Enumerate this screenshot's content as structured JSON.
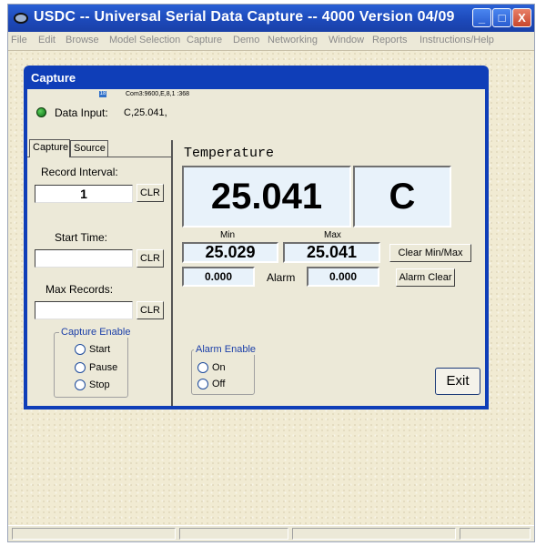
{
  "window": {
    "title": "USDC -- Universal Serial Data Capture -- 4000   Version 04/09",
    "minimize": "_",
    "maximize": "□",
    "close": "X"
  },
  "menu": [
    "File",
    "Edit",
    "Browse",
    "Model Selection",
    "Capture",
    "Demo",
    "Networking",
    "Window",
    "Reports",
    "Instructions/Help"
  ],
  "capture": {
    "title": "Capture",
    "port_badge": "18",
    "port_settings": "Com3:9600,E,8,1 :368",
    "data_input_label": "Data Input:",
    "data_input_value": "C,25.041,",
    "tabs": [
      "Capture",
      "Source"
    ],
    "record_interval_label": "Record Interval:",
    "record_interval_value": "1",
    "start_time_label": "Start Time:",
    "start_time_value": "",
    "max_records_label": "Max Records:",
    "max_records_value": "",
    "clr_label": "CLR",
    "capture_enable": {
      "label": "Capture Enable",
      "options": [
        "Start",
        "Pause",
        "Stop"
      ]
    },
    "measurement_label": "Temperature",
    "value": "25.041",
    "unit": "C",
    "min_label": "Min",
    "max_label": "Max",
    "min_value": "25.029",
    "max_value": "25.041",
    "clear_minmax_label": "Clear Min/Max",
    "alarm_low_value": "0.000",
    "alarm_label": "Alarm",
    "alarm_high_value": "0.000",
    "alarm_clear_label": "Alarm Clear",
    "alarm_enable": {
      "label": "Alarm Enable",
      "options": [
        "On",
        "Off"
      ]
    },
    "exit_label": "Exit"
  }
}
